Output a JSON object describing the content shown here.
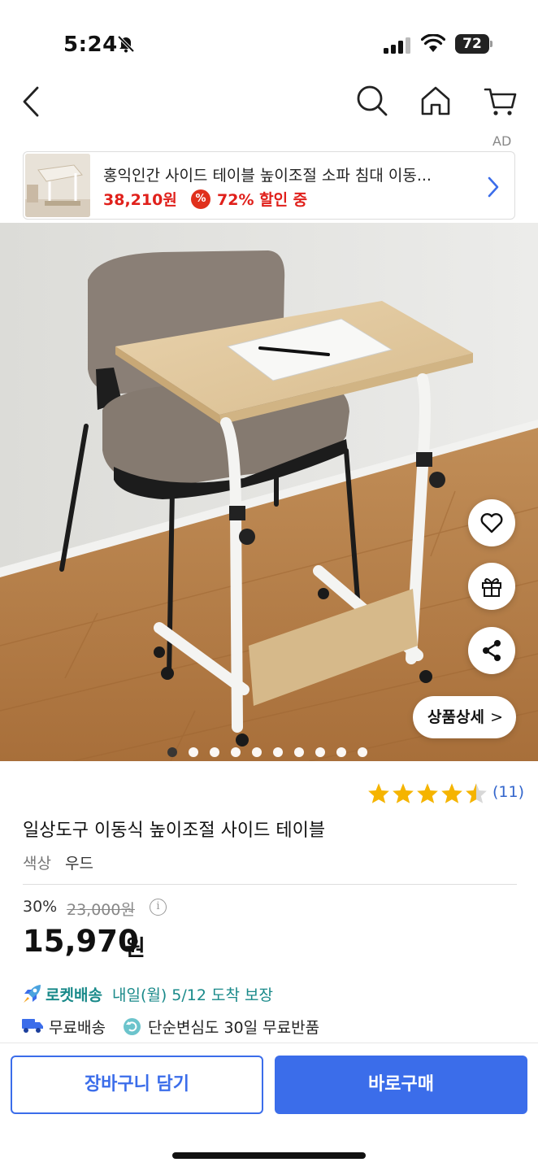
{
  "status_bar": {
    "time": "5:24",
    "battery": "72"
  },
  "nav": {
    "ad_label": "AD"
  },
  "ad_banner": {
    "title": "홍익인간 사이드 테이블 높이조절 소파 침대 이동...",
    "price": "38,210원",
    "badge_symbol": "%",
    "discount": "72% 할인 중"
  },
  "hero": {
    "detail_button_label": "상품상세",
    "detail_button_chevron": ">",
    "image_count": 10,
    "active_index": 0
  },
  "product": {
    "rating": 4.5,
    "review_count": "(11)",
    "title": "일상도구 이동식 높이조절 사이드 테이블",
    "option_label": "색상",
    "option_value": "우드",
    "discount_percent": "30%",
    "original_price": "23,000원",
    "info_symbol": "i",
    "sale_price": "15,970",
    "sale_currency": "원",
    "rocket_label": "로켓배송",
    "delivery_text": "내일(월) 5/12 도착 보장",
    "free_shipping": "무료배송",
    "return_policy": "단순변심도 30일 무료반품"
  },
  "actions": {
    "cart_label": "장바구니 담기",
    "buy_label": "바로구매"
  },
  "colors": {
    "accent": "#3b6dea",
    "sale_red": "#e0201b",
    "rocket_teal": "#1a8a8a",
    "star": "#f5b400"
  },
  "icons": [
    "back-icon",
    "search-icon",
    "home-icon",
    "cart-icon",
    "heart-icon",
    "gift-icon",
    "share-icon",
    "rocket-icon",
    "truck-icon",
    "return-icon",
    "info-icon"
  ]
}
